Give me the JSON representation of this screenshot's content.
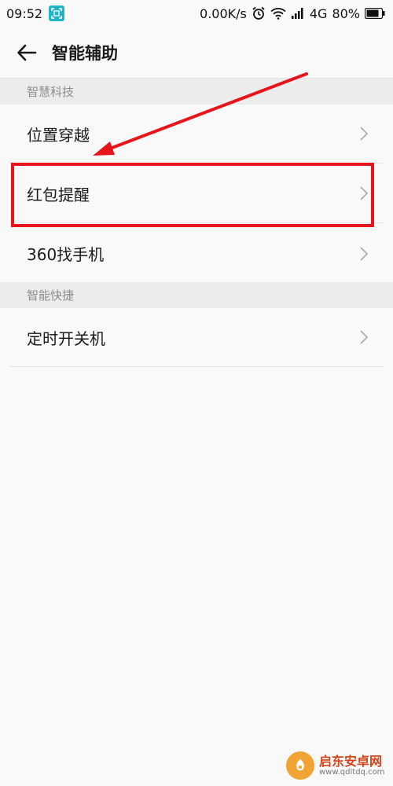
{
  "status_bar": {
    "time": "09:52",
    "speed": "0.00K/s",
    "network": "4G",
    "battery": "80%"
  },
  "header": {
    "title": "智能辅助"
  },
  "sections": [
    {
      "label": "智慧科技"
    },
    {
      "label": "智能快捷"
    }
  ],
  "rows": [
    {
      "label": "位置穿越"
    },
    {
      "label": "红包提醒"
    },
    {
      "label": "360找手机"
    },
    {
      "label": "定时开关机"
    }
  ],
  "annotation": {
    "color": "#e8141b"
  },
  "watermark": {
    "title": "启东安卓网",
    "url": "www.qdltdq.com"
  }
}
